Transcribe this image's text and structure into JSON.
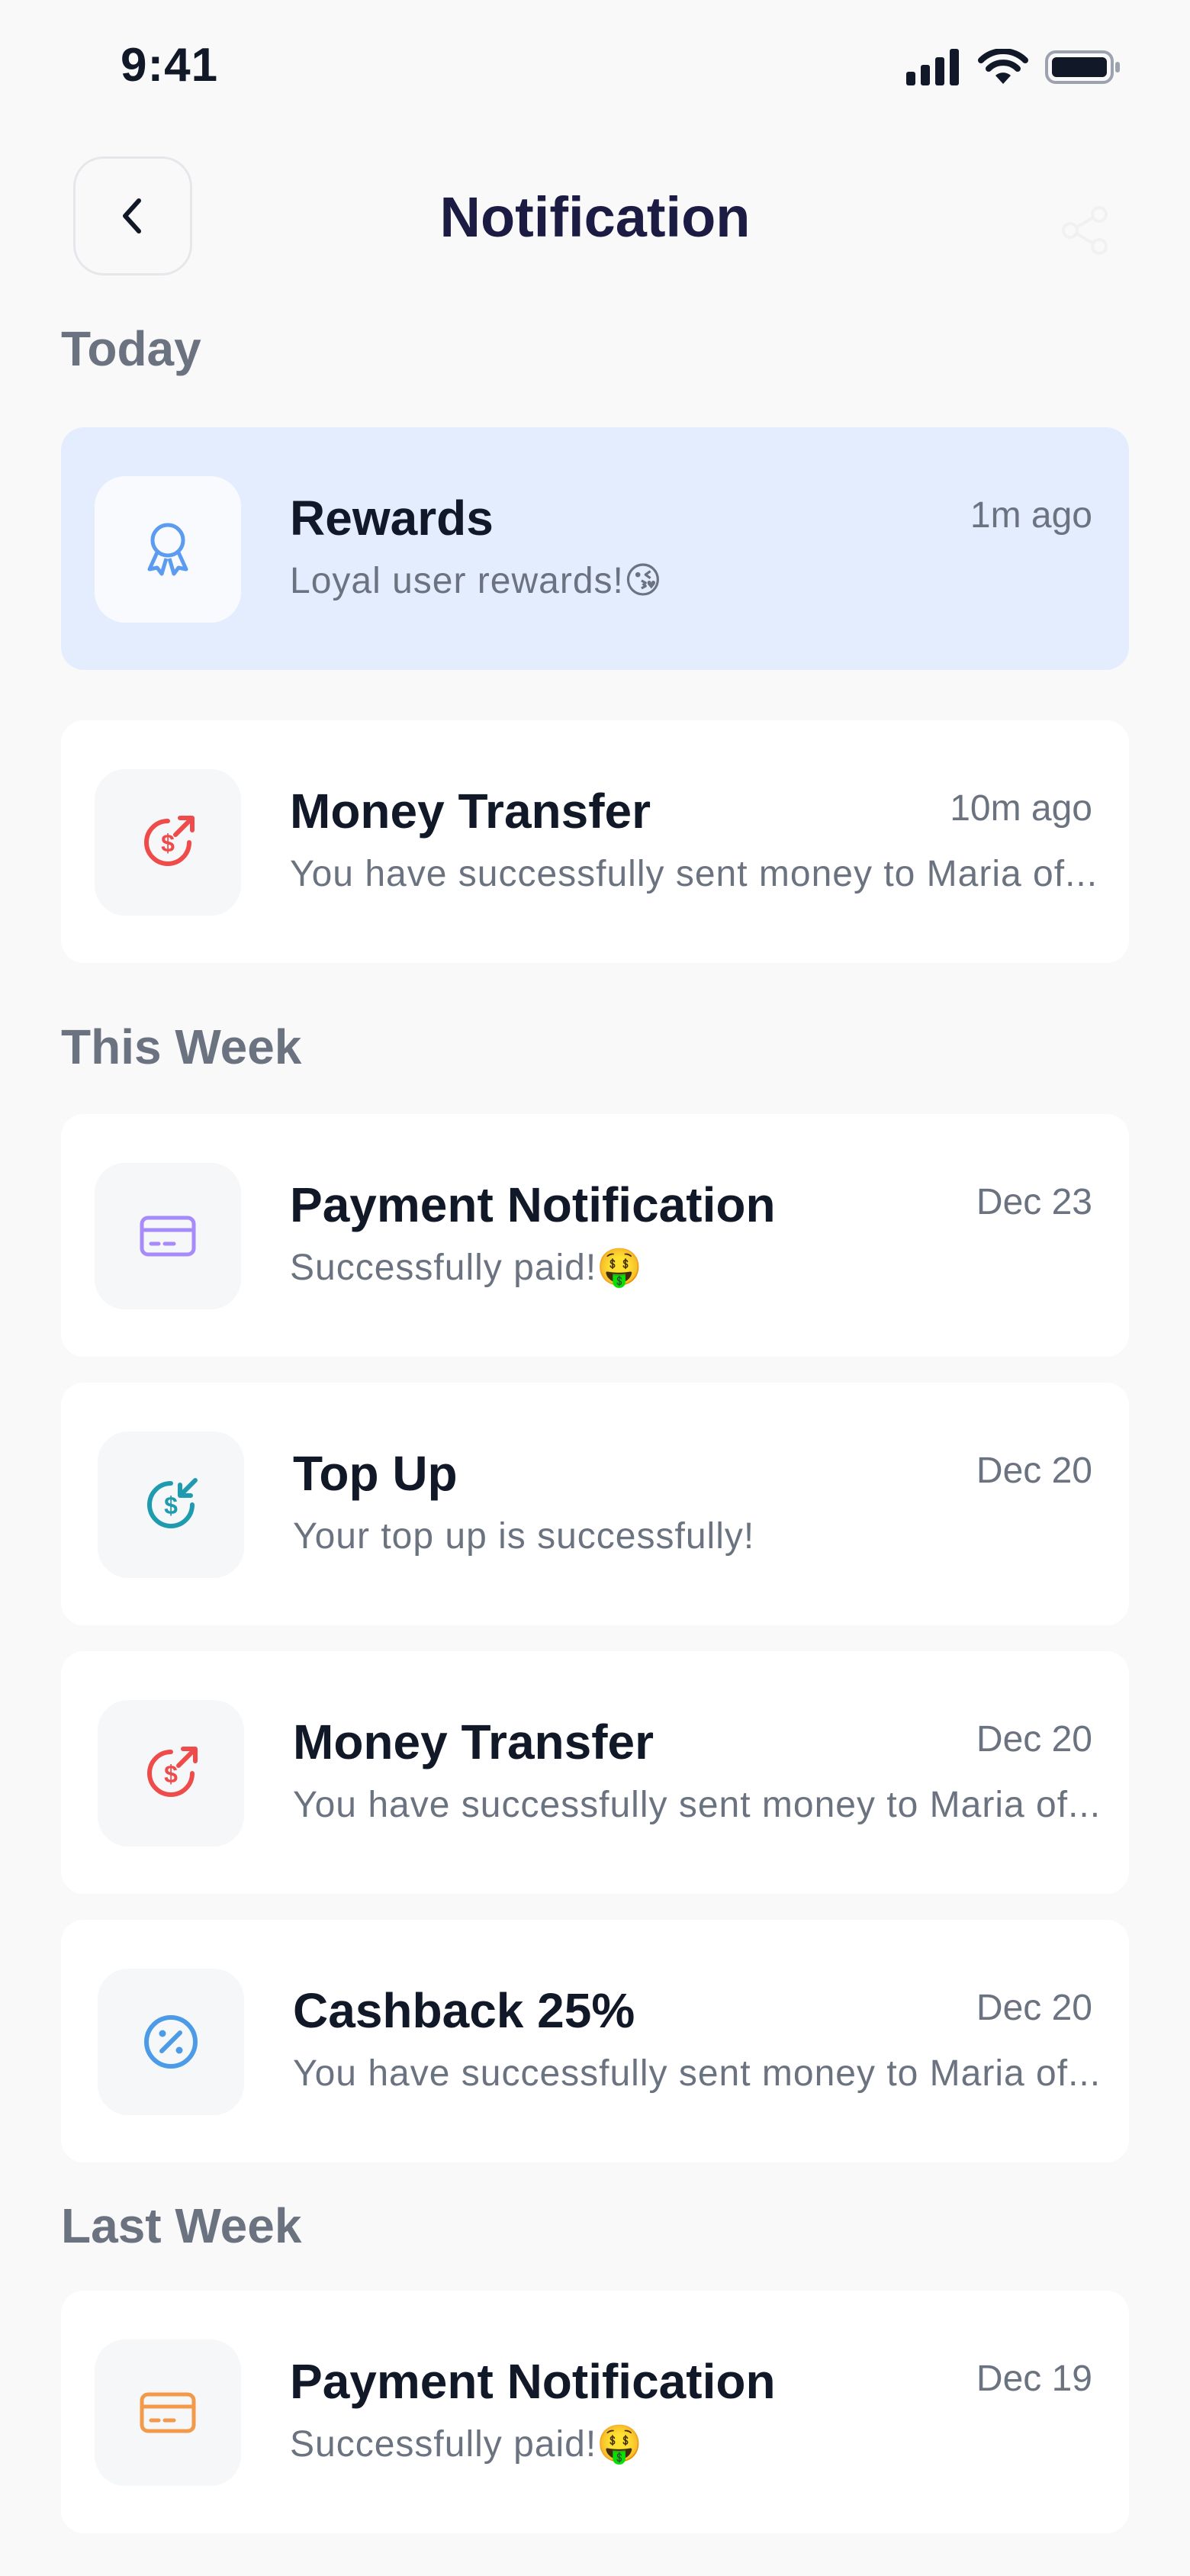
{
  "status_bar": {
    "time": "9:41"
  },
  "header": {
    "title": "Notification"
  },
  "sections": {
    "today": "Today",
    "this_week": "This Week",
    "last_week": "Last Week"
  },
  "notifications": [
    {
      "title": "Rewards",
      "time": "1m ago",
      "message": "Loyal user rewards!😘",
      "icon": "award-ribbon-icon",
      "color": "#5B9BF0",
      "highlighted": true
    },
    {
      "title": "Money Transfer",
      "time": "10m ago",
      "message": "You have successfully sent money to Maria of...",
      "icon": "dollar-send-icon",
      "color": "#EF4B4B"
    },
    {
      "title": "Payment Notification",
      "time": "Dec 23",
      "message": "Successfully paid!🤑",
      "icon": "credit-card-icon",
      "color": "#A78BFA"
    },
    {
      "title": "Top Up",
      "time": "Dec 20",
      "message": "Your top up is successfully!",
      "icon": "dollar-receive-icon",
      "color": "#1E9BAE"
    },
    {
      "title": "Money Transfer",
      "time": "Dec 20",
      "message": "You have successfully sent money to Maria of...",
      "icon": "dollar-send-icon",
      "color": "#EF4B4B"
    },
    {
      "title": "Cashback 25%",
      "time": "Dec 20",
      "message": "You have successfully sent money to Maria of...",
      "icon": "percent-icon",
      "color": "#4B9BE6"
    },
    {
      "title": "Payment Notification",
      "time": "Dec 19",
      "message": "Successfully paid!🤑",
      "icon": "credit-card-icon",
      "color": "#F2994A"
    }
  ]
}
